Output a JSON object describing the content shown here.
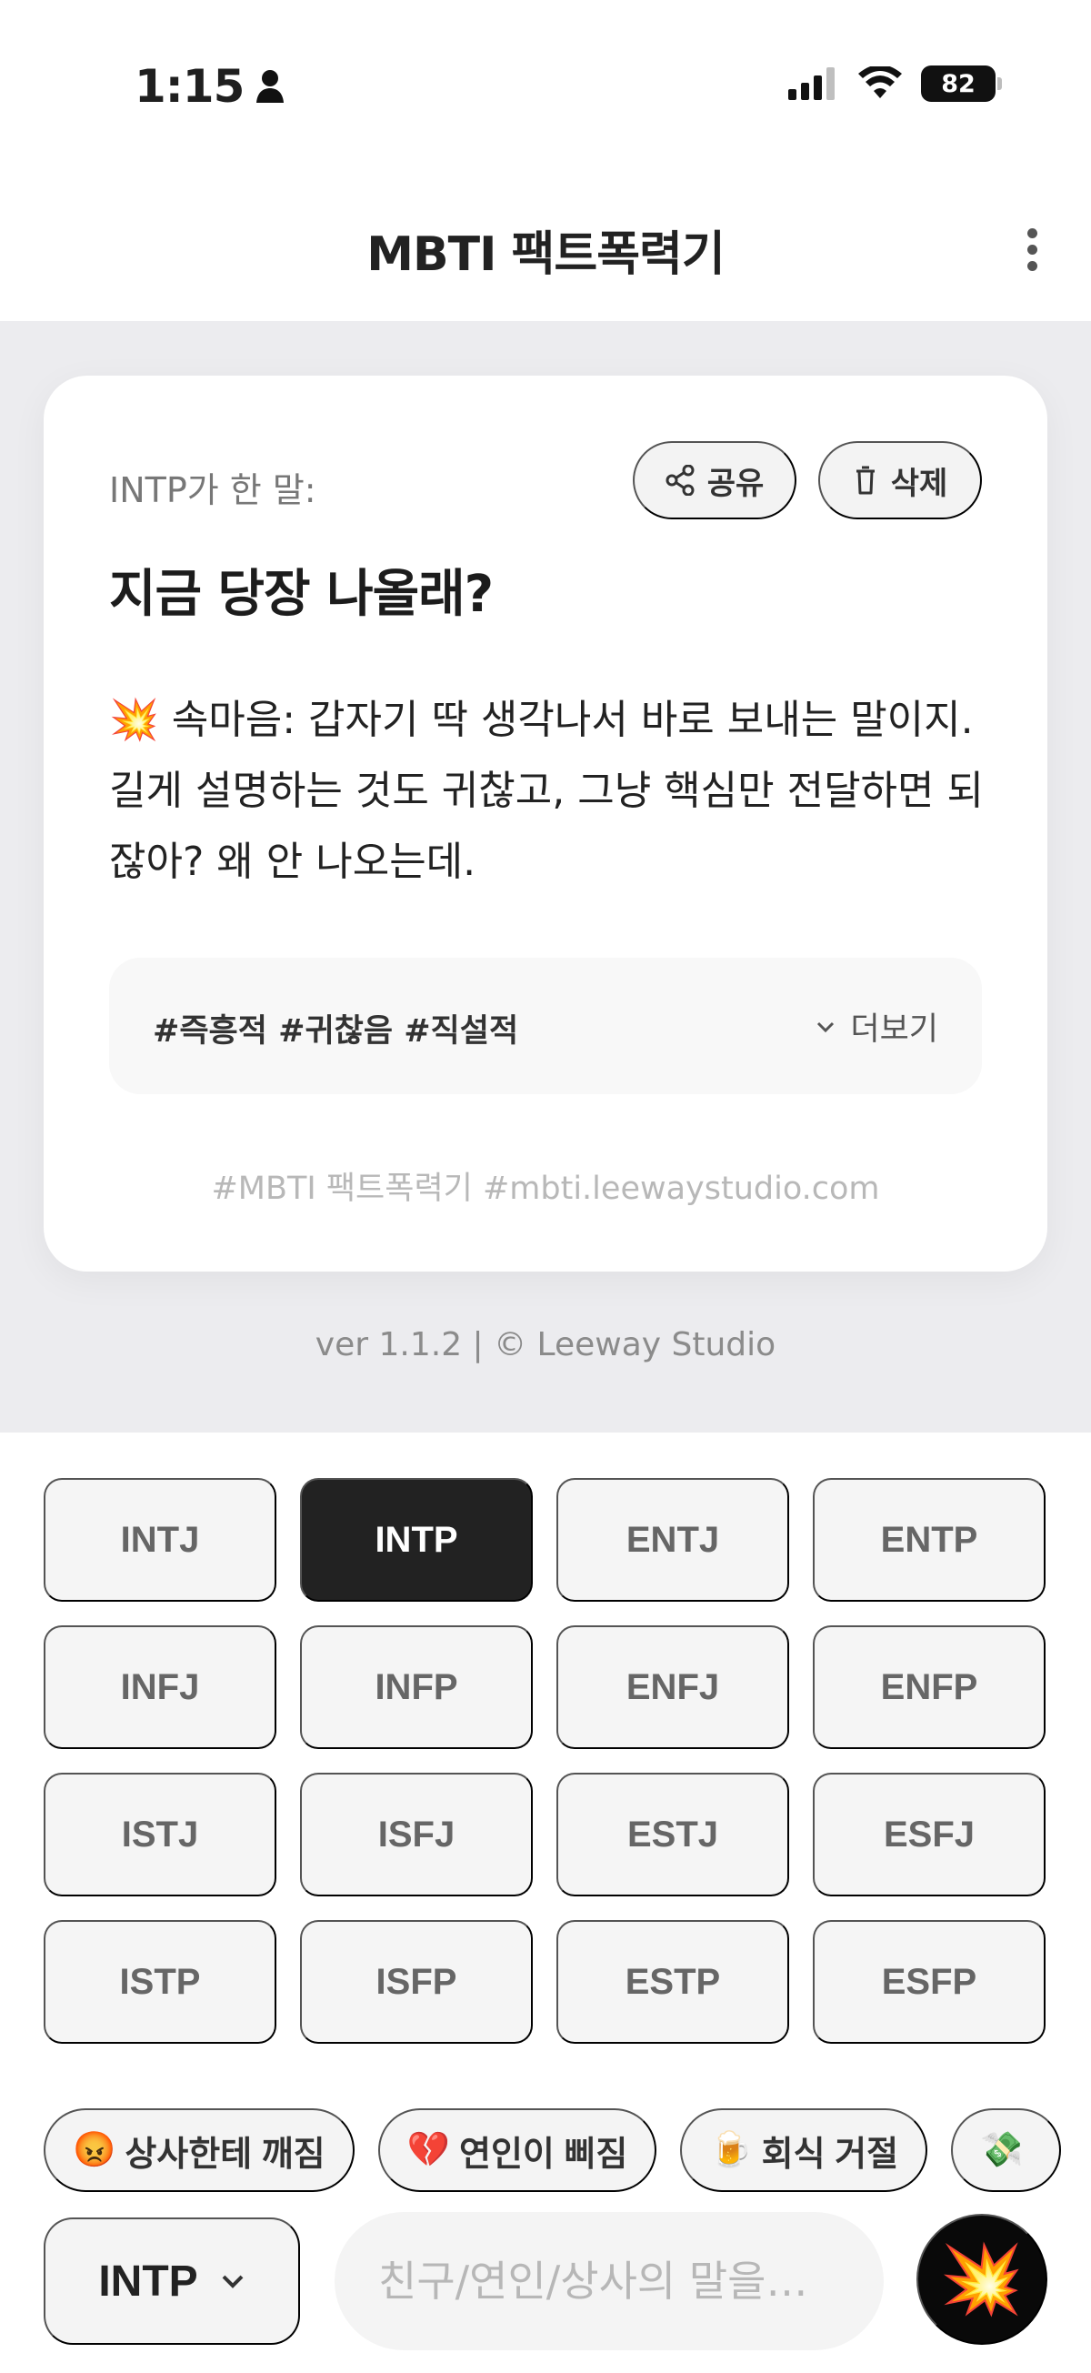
{
  "status": {
    "time": "1:15",
    "battery": "82",
    "icons": [
      "person-icon",
      "signal-icon",
      "wifi-icon",
      "battery-icon"
    ]
  },
  "header": {
    "title": "MBTI 팩트폭력기",
    "menu_icon": "more-vertical-icon"
  },
  "card": {
    "speaker_label": "INTP가 한 말:",
    "share_label": "공유",
    "delete_label": "삭제",
    "quote": "지금 당장 나올래?",
    "thought": "💥 속마음: 갑자기 딱 생각나서 바로 보내는 말이지. 길게 설명하는 것도 귀찮고, 그냥 핵심만 전달하면 되잖아? 왜 안 나오는데.",
    "tags": "#즉흥적 #귀찮음 #직설적",
    "more_label": "더보기",
    "watermark": "#MBTI 팩트폭력기 #mbti.leewaystudio.com"
  },
  "footer": {
    "version": "ver 1.1.2 | © Leeway Studio"
  },
  "mbti_types": [
    {
      "label": "INTJ"
    },
    {
      "label": "INTP",
      "selected": true
    },
    {
      "label": "ENTJ"
    },
    {
      "label": "ENTP"
    },
    {
      "label": "INFJ"
    },
    {
      "label": "INFP"
    },
    {
      "label": "ENFJ"
    },
    {
      "label": "ENFP"
    },
    {
      "label": "ISTJ"
    },
    {
      "label": "ISFJ"
    },
    {
      "label": "ESTJ"
    },
    {
      "label": "ESFJ"
    },
    {
      "label": "ISTP"
    },
    {
      "label": "ISFP"
    },
    {
      "label": "ESTP"
    },
    {
      "label": "ESFP"
    }
  ],
  "chips": [
    {
      "emoji": "😡",
      "label": "상사한테 깨짐"
    },
    {
      "emoji": "💔",
      "label": "연인이 삐짐"
    },
    {
      "emoji": "🍺",
      "label": "회식 거절"
    },
    {
      "emoji": "💸",
      "label": ""
    }
  ],
  "composer": {
    "selected_type": "INTP",
    "placeholder": "친구/연인/상사의 말을…",
    "send_emoji": "💥"
  },
  "colors": {
    "background": "#ececef",
    "card": "#ffffff",
    "selected": "#222222",
    "button": "#f5f5f5"
  }
}
